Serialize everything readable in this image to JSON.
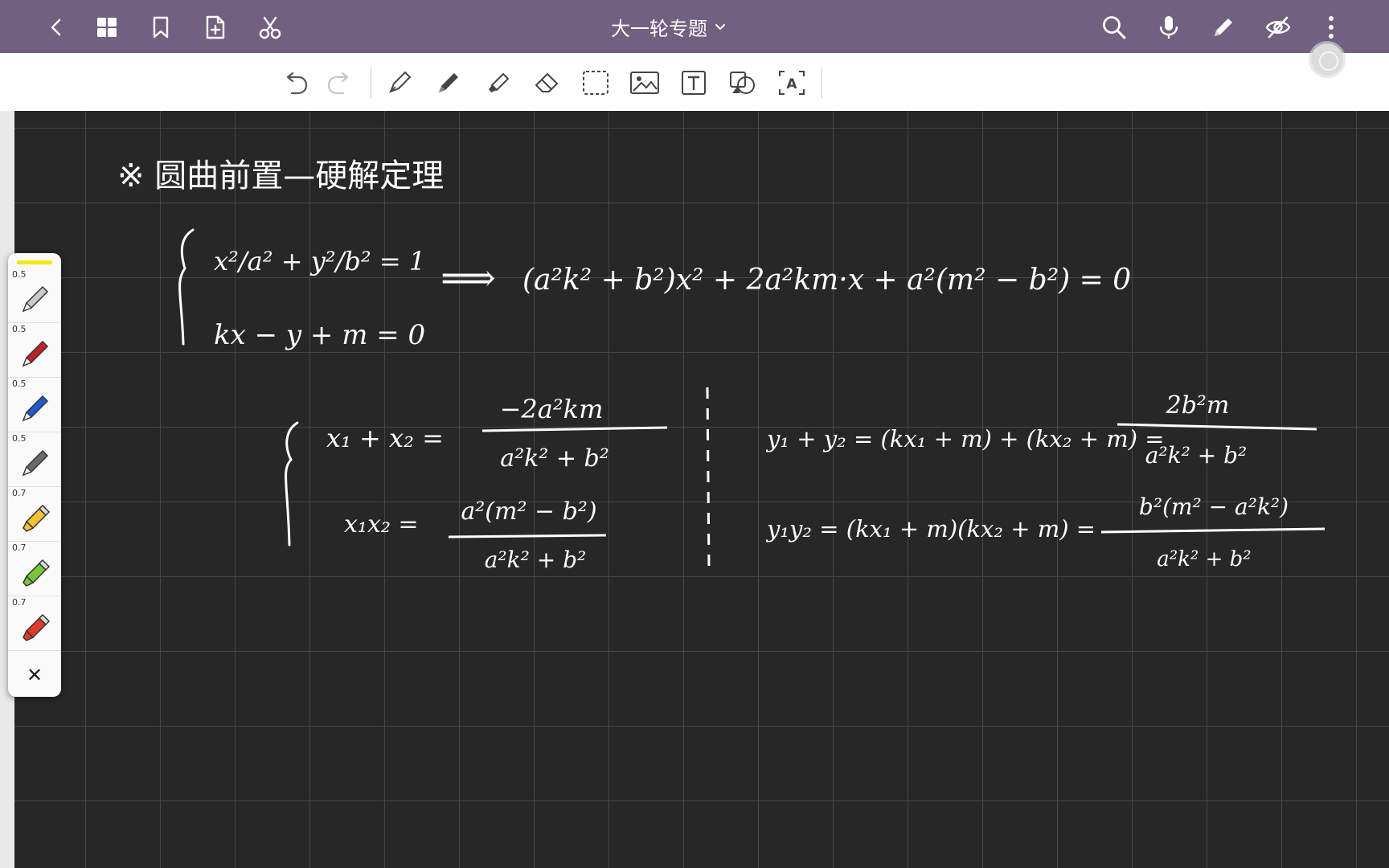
{
  "window": {
    "title": "大一轮专题"
  },
  "top_icons": [
    "back-icon",
    "grid-icon",
    "bookmark-icon",
    "add-page-icon",
    "scissors-icon",
    "search-icon",
    "microphone-icon",
    "pencil-icon",
    "eye-off-icon",
    "more-vertical-icon"
  ],
  "toolbar": {
    "tools": [
      "undo-icon",
      "redo-icon",
      "fountain-pen-icon",
      "ballpoint-pen-icon",
      "highlighter-icon",
      "eraser-icon",
      "lasso-select-icon",
      "image-icon",
      "text-box-icon",
      "shapes-icon",
      "ocr-text-icon"
    ]
  },
  "pen_panel": {
    "highlight_color": "#f5e616",
    "pens": [
      {
        "size": "0.5",
        "color": "#c9c9c9",
        "kind": "pen"
      },
      {
        "size": "0.5",
        "color": "#c0202a",
        "kind": "pen"
      },
      {
        "size": "0.5",
        "color": "#1c5bd1",
        "kind": "pen"
      },
      {
        "size": "0.5",
        "color": "#6b6b6b",
        "kind": "pen"
      },
      {
        "size": "0.7",
        "color": "#f2c232",
        "kind": "marker"
      },
      {
        "size": "0.7",
        "color": "#7cc63c",
        "kind": "marker"
      },
      {
        "size": "0.7",
        "color": "#e23a2b",
        "kind": "marker"
      }
    ],
    "close_label": "✕"
  },
  "notes": {
    "heading": "※ 圆曲前置—硬解定理",
    "system_eq1": "x²/a² + y²/b² = 1",
    "system_eq2": "kx − y + m = 0",
    "arrow": "⟹",
    "quadratic": "(a²k² + b²)x² + 2a²km·x + a²(m² − b²) = 0",
    "sum_x_left": "x₁ + x₂ =",
    "sum_x_num": "−2a²km",
    "sum_x_den": "a²k² + b²",
    "prod_x_left": "x₁x₂ =",
    "prod_x_num": "a²(m² − b²)",
    "prod_x_den": "a²k² + b²",
    "sum_y_left": "y₁ + y₂ = (kx₁ + m) + (kx₂ + m) =",
    "sum_y_num": "2b²m",
    "sum_y_den": "a²k² + b²",
    "prod_y_left": "y₁y₂ = (kx₁ + m)(kx₂ + m) =",
    "prod_y_num": "b²(m² − a²k²)",
    "prod_y_den": "a²k² + b²"
  }
}
